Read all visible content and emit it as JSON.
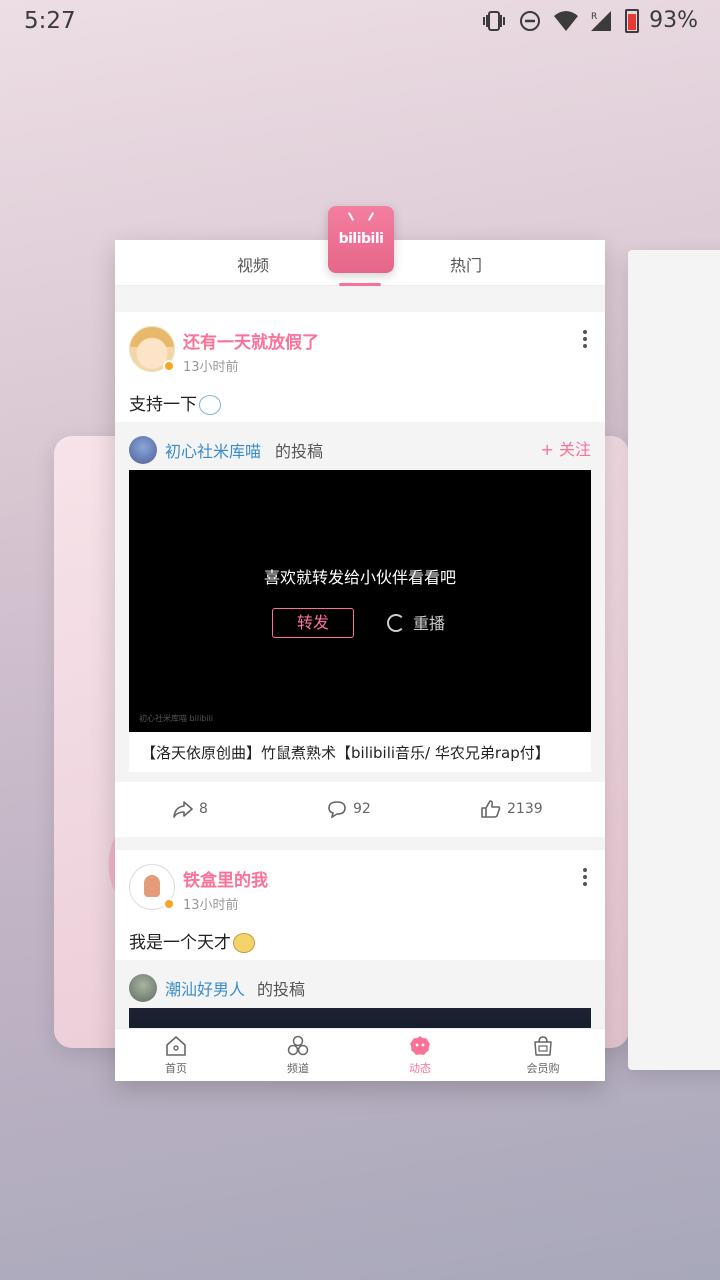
{
  "status_bar": {
    "time": "5:27",
    "battery": "93%"
  },
  "app": {
    "top_tabs": [
      {
        "label": "视频"
      },
      {
        "label": "热门"
      }
    ],
    "logo_text": "bilibili",
    "posts": [
      {
        "author": "还有一天就放假了",
        "time": "13小时前",
        "text": "支持一下",
        "repost": {
          "author": "初心社米库喵",
          "suffix": "的投稿",
          "follow_label": "+ 关注",
          "video": {
            "prompt": "喜欢就转发给小伙伴看看吧",
            "share_label": "转发",
            "replay_label": "重播",
            "watermark": "初心社米库喵 bilibili",
            "title": "【洛天依原创曲】竹鼠煮熟术【bilibili音乐/ 华农兄弟rap付】"
          }
        },
        "stats": {
          "shares": "8",
          "comments": "92",
          "likes": "2139"
        }
      },
      {
        "author": "铁盒里的我",
        "time": "13小时前",
        "text": "我是一个天才",
        "repost": {
          "author": "潮汕好男人",
          "suffix": "的投稿"
        }
      }
    ],
    "bottom_nav": [
      {
        "label": "首页",
        "icon": "home-icon"
      },
      {
        "label": "频道",
        "icon": "channel-icon"
      },
      {
        "label": "动态",
        "icon": "dynamic-icon",
        "active": true
      },
      {
        "label": "会员购",
        "icon": "shop-icon"
      }
    ]
  },
  "colors": {
    "accent": "#fb7299",
    "link": "#3a8dcc"
  }
}
